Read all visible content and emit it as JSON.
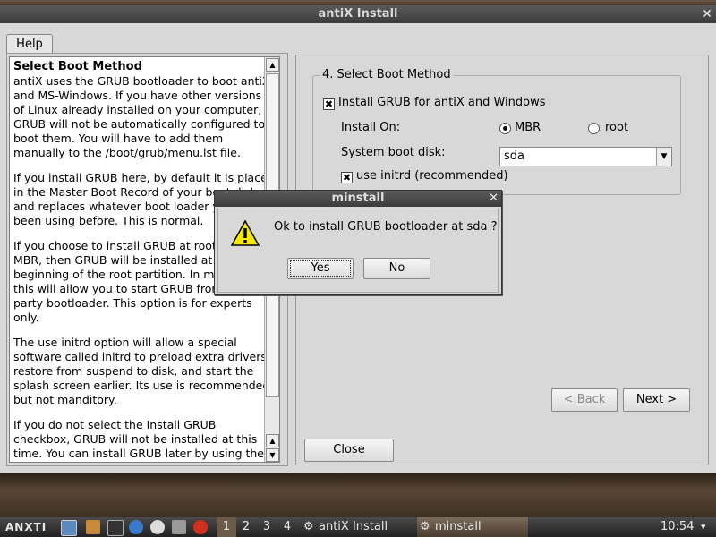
{
  "window": {
    "title": "antiX Install"
  },
  "help_tab": {
    "label": "Help"
  },
  "help": {
    "heading": "Select Boot Method",
    "p1": "antiX uses the GRUB bootloader to boot antiX and MS-Windows. If you have other versions of Linux already installed on your computer, GRUB will not be automatically configured to boot them. You will have to add them manually to the /boot/grub/menu.lst file.",
    "p2": "If you install GRUB here, by default it is placed in the Master Boot Record of your boot disk and replaces whatever boot loader you have been using before. This is normal.",
    "p3": "If you choose to install GRUB at root instead of MBR, then GRUB will be installed at the beginning of the root partition. In most cases, this will allow you to start GRUB from a third party bootloader. This option is for experts only.",
    "p4": "The use initrd option will allow a special software called initrd to preload extra drivers, restore from suspend to disk, and start the splash screen earlier. Its use is recommended, but not manditory.",
    "p5": "If you do not select the Install GRUB checkbox, GRUB will not be installed at this time. You can install GRUB later by using the"
  },
  "boot": {
    "group_title": "4. Select Boot Method",
    "install_grub_label": "Install GRUB for antiX and Windows",
    "install_on_label": "Install On:",
    "mbr_label": "MBR",
    "root_label": "root",
    "system_disk_label": "System boot disk:",
    "system_disk_value": "sda",
    "initrd_label": "use initrd (recommended)",
    "check_mark": "✖"
  },
  "nav": {
    "back_label": "< Back",
    "next_label": "Next >",
    "close_label": "Close"
  },
  "dialog": {
    "title": "minstall",
    "message": "Ok to install GRUB bootloader at sda ?",
    "yes_label": "Yes",
    "no_label": "No"
  },
  "taskbar": {
    "logo": "ANXTI",
    "workspaces": [
      "1",
      "2",
      "3",
      "4"
    ],
    "tasks": [
      "antiX Install",
      "minstall"
    ],
    "clock": "10:54"
  }
}
